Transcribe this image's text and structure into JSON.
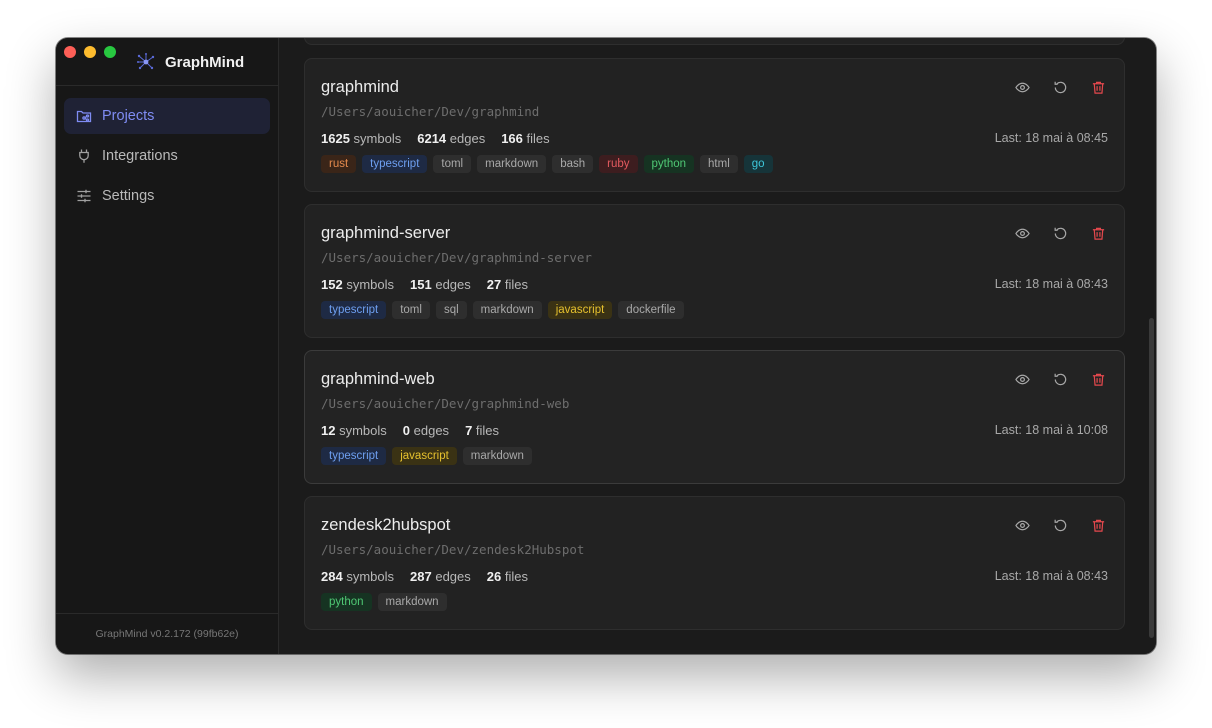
{
  "app": {
    "name": "GraphMind",
    "version": "GraphMind v0.2.172 (99fb62e)"
  },
  "sidebar": {
    "items": [
      {
        "label": "Projects",
        "icon": "folder-graph-icon",
        "active": true
      },
      {
        "label": "Integrations",
        "icon": "plug-icon",
        "active": false
      },
      {
        "label": "Settings",
        "icon": "sliders-icon",
        "active": false
      }
    ]
  },
  "colors": {
    "accent": "#7f8cf3",
    "delete": "#e5484d",
    "traffic_red": "#fe5f57",
    "traffic_yellow": "#febc2e",
    "traffic_green": "#28c840"
  },
  "labels": {
    "symbols": "symbols",
    "edges": "edges",
    "files": "files"
  },
  "projects": [
    {
      "name": "graphmind",
      "path": "/Users/aouicher/Dev/graphmind",
      "symbols": "1625",
      "edges": "6214",
      "files": "166",
      "last": "Last: 18 mai à 08:45",
      "tags": [
        "rust",
        "typescript",
        "toml",
        "markdown",
        "bash",
        "ruby",
        "python",
        "html",
        "go"
      ]
    },
    {
      "name": "graphmind-server",
      "path": "/Users/aouicher/Dev/graphmind-server",
      "symbols": "152",
      "edges": "151",
      "files": "27",
      "last": "Last: 18 mai à 08:43",
      "tags": [
        "typescript",
        "toml",
        "sql",
        "markdown",
        "javascript",
        "dockerfile"
      ]
    },
    {
      "name": "graphmind-web",
      "path": "/Users/aouicher/Dev/graphmind-web",
      "symbols": "12",
      "edges": "0",
      "files": "7",
      "last": "Last: 18 mai à 10:08",
      "tags": [
        "typescript",
        "javascript",
        "markdown"
      ]
    },
    {
      "name": "zendesk2hubspot",
      "path": "/Users/aouicher/Dev/zendesk2Hubspot",
      "symbols": "284",
      "edges": "287",
      "files": "26",
      "last": "Last: 18 mai à 08:43",
      "tags": [
        "python",
        "markdown"
      ]
    }
  ]
}
